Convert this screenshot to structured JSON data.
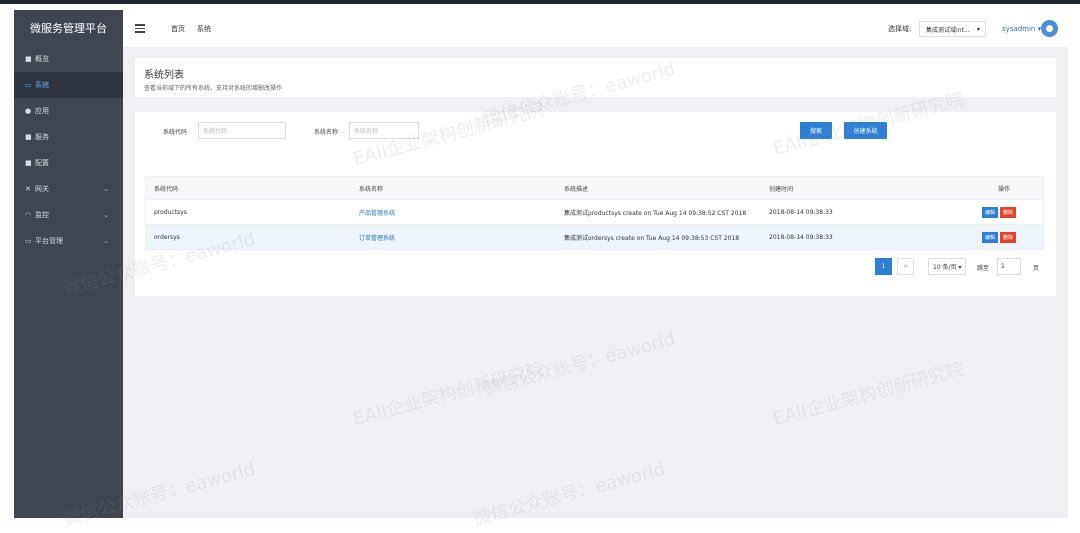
{
  "app": {
    "title": "微服务管理平台"
  },
  "sidebar": {
    "items": [
      {
        "label": "概览",
        "icon": "home-icon"
      },
      {
        "label": "系统",
        "icon": "monitor-icon",
        "active": true
      },
      {
        "label": "应用",
        "icon": "app-icon"
      },
      {
        "label": "服务",
        "icon": "service-icon"
      },
      {
        "label": "配置",
        "icon": "config-icon"
      },
      {
        "label": "网关",
        "icon": "shuffle-icon",
        "expandable": true
      },
      {
        "label": "监控",
        "icon": "monitor-gauge-icon",
        "expandable": true
      },
      {
        "label": "平台管理",
        "icon": "screen-icon",
        "expandable": true
      }
    ]
  },
  "header": {
    "breadcrumb": [
      "首页",
      "系统"
    ],
    "env_label": "选择域:",
    "env_value": "集成测试域int...",
    "user": "sysadmin ▾"
  },
  "page": {
    "title": "系统列表",
    "subtitle": "查看当前域下的所有系统、支持对系统的增删改操作"
  },
  "filters": {
    "code_label": "系统代码",
    "code_placeholder": "系统代码",
    "name_label": "系统名称",
    "name_placeholder": "系统名称",
    "search_button": "搜索",
    "create_button": "创建系统"
  },
  "table": {
    "columns": [
      "系统代码",
      "系统名称",
      "系统描述",
      "创建时间",
      "操作"
    ],
    "rows": [
      {
        "code": "productsys",
        "name": "产品管理系统",
        "desc": "集成测试productsys create on Tue Aug 14 09:38:52 CST 2018",
        "created": "2018-08-14 09:38:33"
      },
      {
        "code": "ordersys",
        "name": "订单管理系统",
        "desc": "集成测试ordersys create on Tue Aug 14 09:38:53 CST 2018",
        "created": "2018-08-14 09:38:33"
      }
    ],
    "edit_label": "编辑",
    "delete_label": "删除"
  },
  "pagination": {
    "current": "1",
    "next": ">",
    "page_size": "10 条/页 ▾",
    "jump_label": "跳至",
    "jump_value": "1",
    "page_suffix": "页"
  },
  "watermarks": [
    "EAII企业架构创新研究院",
    "微信公众账号：eaworld"
  ],
  "colors": {
    "accent": "#2d7fd6",
    "danger": "#e0452b",
    "sidebar": "#3f4652"
  }
}
